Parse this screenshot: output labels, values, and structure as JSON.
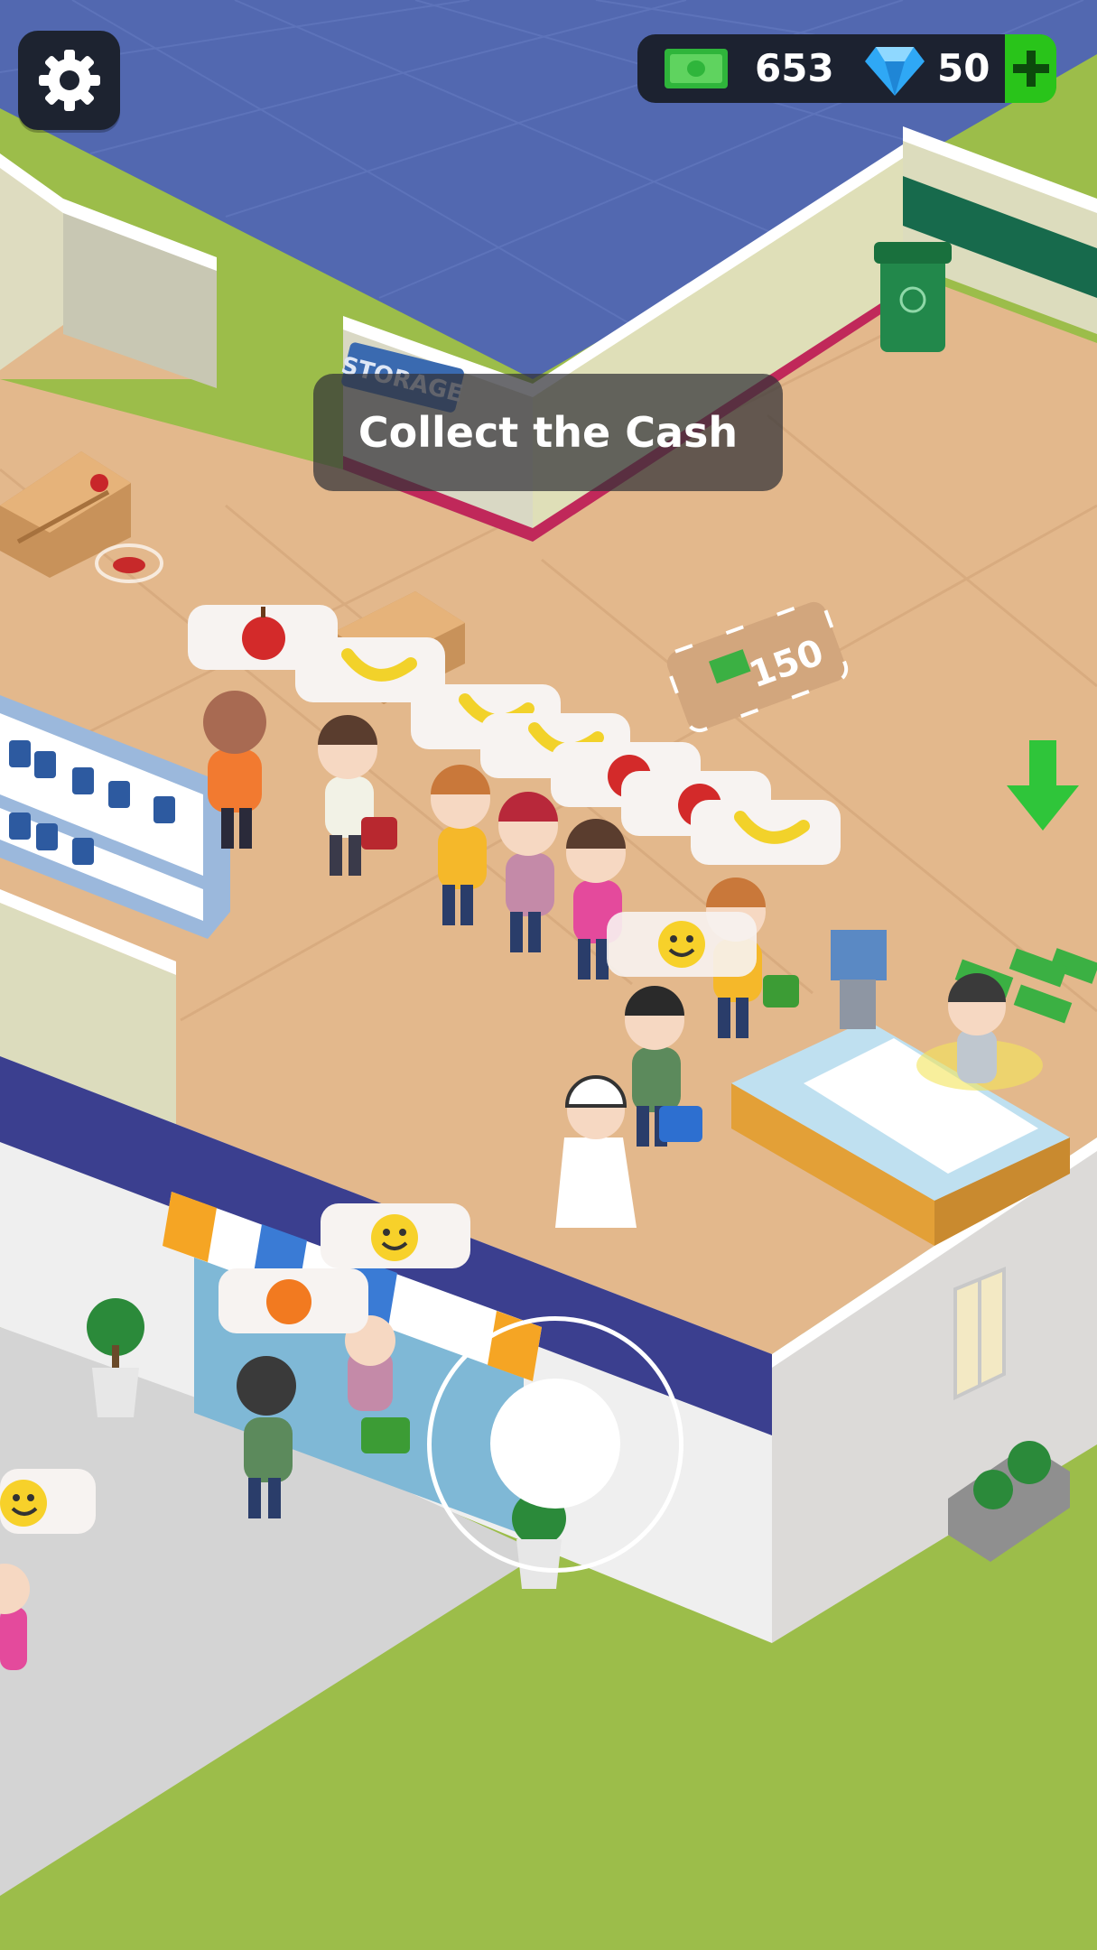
{
  "hud": {
    "cash_value": "653",
    "gem_value": "50",
    "cash_icon": "cash-stack-icon",
    "gem_icon": "diamond-icon",
    "add_icon": "plus-icon",
    "settings_icon": "gear-icon"
  },
  "objective": {
    "text": "Collect the Cash"
  },
  "world": {
    "storage_sign": "STORAGE",
    "cash_spot_price": "150",
    "bubbles": [
      "apple",
      "banana",
      "banana",
      "banana",
      "apple",
      "apple",
      "banana",
      "smiley",
      "smiley",
      "orange",
      "smiley"
    ]
  },
  "colors": {
    "accent_green": "#29c41a",
    "hud_dark": "#1c2230",
    "floor_wood": "#e3b88c",
    "wall_blue": "#3b3f8f",
    "grass": "#9cbd4a"
  }
}
